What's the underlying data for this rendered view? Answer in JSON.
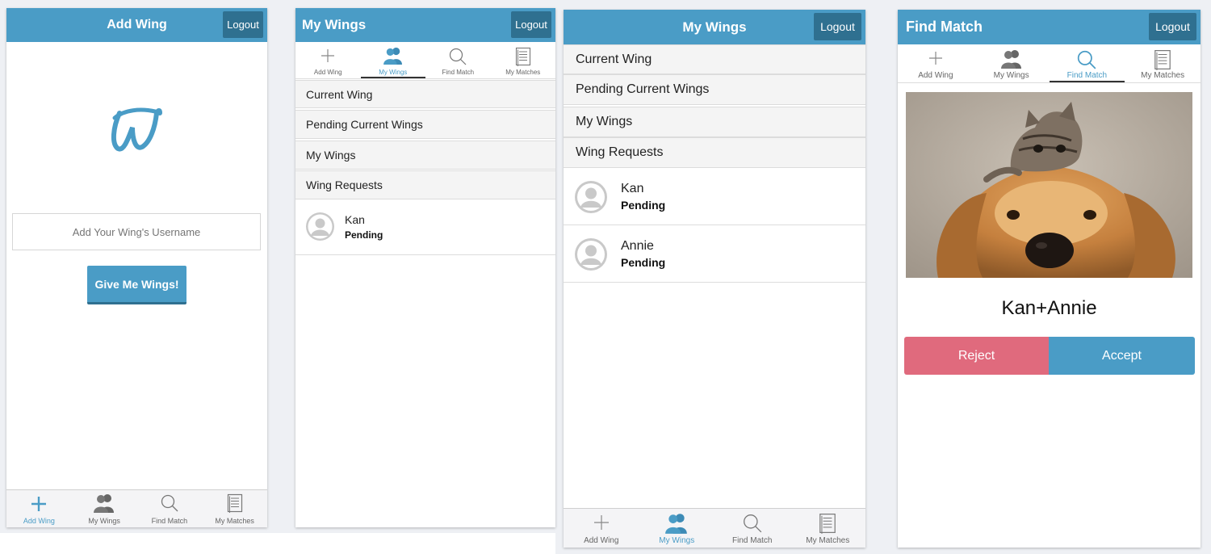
{
  "screens": {
    "add_wing": {
      "title": "Add Wing",
      "logout": "Logout",
      "logo_text": "W",
      "username_placeholder": "Add Your Wing's Username",
      "submit": "Give Me Wings!"
    },
    "my_wings_a": {
      "title": "My Wings",
      "logout": "Logout",
      "sections": [
        "Current Wing",
        "Pending Current Wings",
        "My Wings",
        "Wing Requests"
      ],
      "requests": [
        {
          "name": "Kan",
          "status": "Pending"
        }
      ]
    },
    "my_wings_b": {
      "title": "My Wings",
      "logout": "Logout",
      "sections": [
        "Current Wing",
        "Pending Current Wings",
        "My Wings",
        "Wing Requests"
      ],
      "requests": [
        {
          "name": "Kan",
          "status": "Pending"
        },
        {
          "name": "Annie",
          "status": "Pending"
        }
      ]
    },
    "find_match": {
      "title": "Find Match",
      "logout": "Logout",
      "match_name": "Kan+Annie",
      "reject": "Reject",
      "accept": "Accept"
    }
  },
  "tabs": [
    "Add Wing",
    "My Wings",
    "Find Match",
    "My Matches"
  ],
  "tab_icons": [
    "plus-icon",
    "people-icon",
    "magnifier-icon",
    "document-icon"
  ],
  "colors": {
    "accent": "#4a9cc6",
    "logout_bg": "#2f7090",
    "reject": "#e06a7d",
    "accept": "#4a9cc6"
  }
}
